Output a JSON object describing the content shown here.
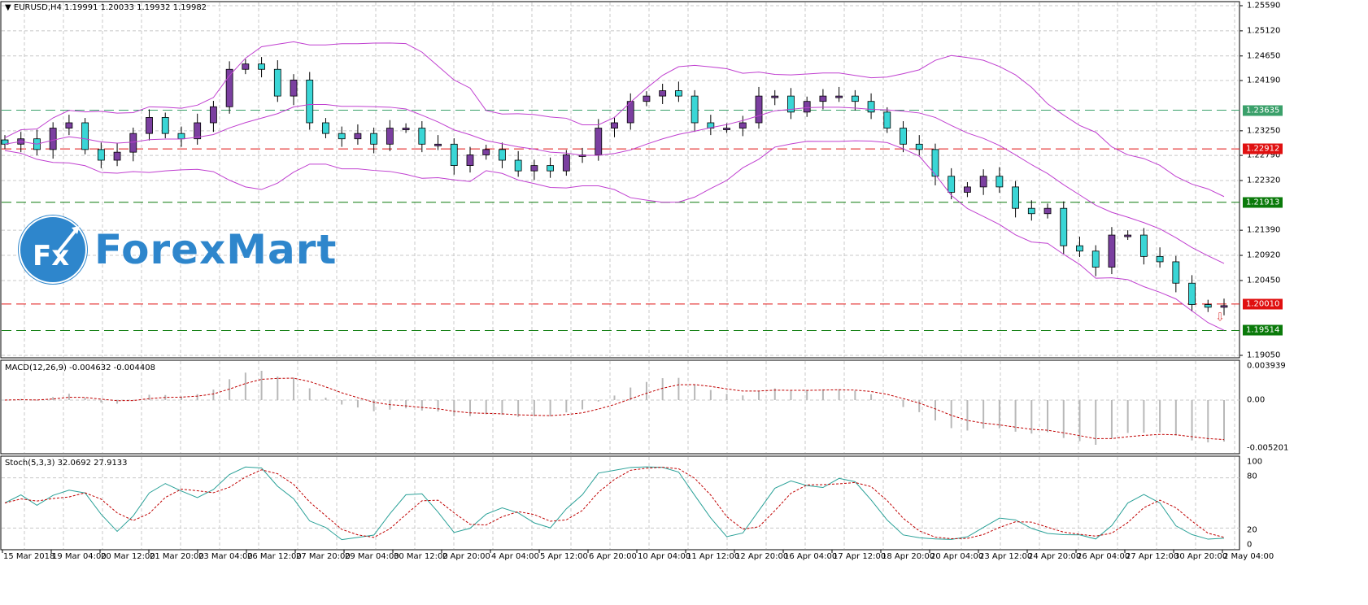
{
  "header": {
    "symbol": "EURUSD,H4",
    "ohlc": "1.19991 1.20033 1.19932 1.19982"
  },
  "macd": {
    "label": "MACD(12,26,9) -0.004632 -0.004408",
    "ticks": [
      "0.003939",
      "0.00",
      "-0.005201"
    ]
  },
  "stoch": {
    "label": "Stoch(5,3,3) 32.0692 27.9133",
    "ticks": [
      "100",
      "80",
      "20",
      "0"
    ]
  },
  "logo": {
    "text": "ForexMart",
    "mark": "Fx"
  },
  "colors": {
    "bull": "#7b3fa0",
    "bear": "#3ad6d6",
    "band": "#c040d0",
    "signal": "#c00000",
    "stochMain": "#2aa198"
  },
  "chart_data": {
    "type": "candlestick",
    "title": "EURUSD,H4",
    "ylim": [
      1.1905,
      1.2559
    ],
    "price_ticks": [
      "1.25590",
      "1.25120",
      "1.24650",
      "1.24190",
      "1.23250",
      "1.22790",
      "1.22320",
      "1.21390",
      "1.20920",
      "1.20450",
      "1.19050"
    ],
    "levels": [
      {
        "value": "1.23635",
        "color": "#3aa06a"
      },
      {
        "value": "1.22912",
        "color": "#e01010"
      },
      {
        "value": "1.21913",
        "color": "#0a7a0a"
      },
      {
        "value": "1.20010",
        "color": "#e01010"
      },
      {
        "value": "1.19514",
        "color": "#0a7a0a"
      }
    ],
    "time_labels": [
      "15 Mar 2018",
      "19 Mar 04:00",
      "20 Mar 12:00",
      "21 Mar 20:00",
      "23 Mar 04:00",
      "26 Mar 12:00",
      "27 Mar 20:00",
      "29 Mar 04:00",
      "30 Mar 12:00",
      "2 Apr 20:00",
      "4 Apr 04:00",
      "5 Apr 12:00",
      "6 Apr 20:00",
      "10 Apr 04:00",
      "11 Apr 12:00",
      "12 Apr 20:00",
      "16 Apr 04:00",
      "17 Apr 12:00",
      "18 Apr 20:00",
      "20 Apr 04:00",
      "23 Apr 12:00",
      "24 Apr 20:00",
      "26 Apr 04:00",
      "27 Apr 12:00",
      "30 Apr 20:00",
      "2 May 04:00"
    ],
    "close": [
      1.23,
      1.231,
      1.229,
      1.233,
      1.234,
      1.229,
      1.227,
      1.2285,
      1.232,
      1.235,
      1.232,
      1.231,
      1.234,
      1.237,
      1.244,
      1.245,
      1.244,
      1.239,
      1.242,
      1.234,
      1.232,
      1.231,
      1.232,
      1.23,
      1.233,
      1.233,
      1.23,
      1.23,
      1.226,
      1.228,
      1.229,
      1.227,
      1.225,
      1.226,
      1.225,
      1.228,
      1.228,
      1.233,
      1.234,
      1.238,
      1.239,
      1.24,
      1.239,
      1.234,
      1.233,
      1.233,
      1.234,
      1.239,
      1.239,
      1.236,
      1.238,
      1.239,
      1.239,
      1.238,
      1.236,
      1.233,
      1.23,
      1.229,
      1.224,
      1.221,
      1.222,
      1.224,
      1.222,
      1.218,
      1.217,
      1.218,
      1.211,
      1.21,
      1.207,
      1.213,
      1.213,
      1.209,
      1.208,
      1.204,
      1.2,
      1.1995,
      1.1998
    ]
  }
}
